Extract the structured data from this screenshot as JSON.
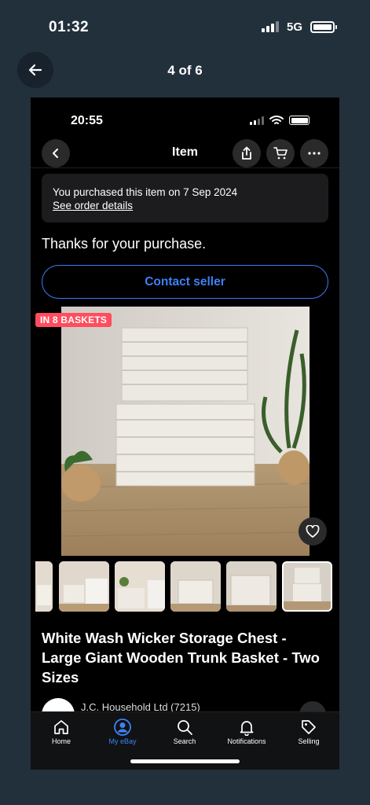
{
  "outer_status": {
    "time": "01:32",
    "network": "5G"
  },
  "viewer": {
    "page_counter": "4 of 6"
  },
  "phone_status": {
    "time": "20:55"
  },
  "nav": {
    "title": "Item"
  },
  "purchase_notice": {
    "text": "You purchased this item on 7 Sep 2024",
    "link": "See order details"
  },
  "thanks_text": "Thanks for your purchase.",
  "contact_button": "Contact seller",
  "main_image": {
    "badge": "IN 8 BASKETS"
  },
  "thumbnails": {
    "count": 6,
    "selected_index": 5
  },
  "listing": {
    "title": "White Wash Wicker Storage Chest - Large Giant Wooden Trunk Basket - Two Sizes"
  },
  "seller": {
    "name": "J.C. Household Ltd (7215)"
  },
  "tabs": [
    {
      "label": "Home",
      "icon": "home-icon"
    },
    {
      "label": "My eBay",
      "icon": "user-icon",
      "active": true
    },
    {
      "label": "Search",
      "icon": "search-icon"
    },
    {
      "label": "Notifications",
      "icon": "bell-icon"
    },
    {
      "label": "Selling",
      "icon": "tag-icon"
    }
  ],
  "colors": {
    "accent": "#3b82f6",
    "badge": "#ff4d5e",
    "background": "#22303c"
  }
}
